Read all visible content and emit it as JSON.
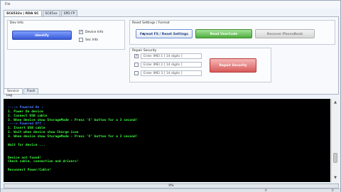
{
  "menu": {
    "file_label": "File"
  },
  "tabs": [
    {
      "label": "SC6532x | RDA SC",
      "active": true
    },
    {
      "label": "SC65xx",
      "active": false
    },
    {
      "label": "SPD FP",
      "active": false
    }
  ],
  "dev_info": {
    "title": "Dev Info",
    "identify_label": "Identify",
    "device_info_label": "Device Info",
    "device_info_checked": true,
    "sec_info_label": "Sec Info",
    "sec_info_checked": false
  },
  "reset": {
    "title": "Reset Settings / Format",
    "format_label": "Format FS / Reset Settings",
    "read_usercode_label": "Read UserCode",
    "recover_phonebook_label": "Recover PhoneBook"
  },
  "repair": {
    "title": "Repair Security",
    "imeis": [
      {
        "placeholder": "Enter IMEI 1 [ 14 digits ]",
        "checked": true
      },
      {
        "placeholder": "Enter IMEI 2 [ 14 digits ]",
        "checked": false
      },
      {
        "placeholder": "Enter IMEI 3 [ 14 digits ]",
        "checked": false
      }
    ],
    "repair_label": "Repair Security"
  },
  "subtabs": [
    {
      "label": "Service",
      "active": true
    },
    {
      "label": "Flash",
      "active": false
    }
  ],
  "log": {
    "label": "Log",
    "lines": [
      {
        "text": "",
        "color": "green"
      },
      {
        "text": "----> Powered On :",
        "color": "blue"
      },
      {
        "text": "1. Power On device",
        "color": "green"
      },
      {
        "text": "2. Connect USB cable",
        "color": "green"
      },
      {
        "text": "3. When device show StorageMode : Press 'X' button for a 3 second!",
        "color": "green"
      },
      {
        "text": "----> Powered Off :",
        "color": "blue"
      },
      {
        "text": "1. Insert USB cable",
        "color": "green"
      },
      {
        "text": "2. Wait when device show Charge icon",
        "color": "green"
      },
      {
        "text": "3. When device show StorageMode : Press 'X' button for a 3 second!",
        "color": "green"
      },
      {
        "text": "",
        "color": "green"
      },
      {
        "text": "Wait for device ...",
        "color": "green"
      },
      {
        "text": "",
        "color": "green"
      },
      {
        "text": "",
        "color": "green"
      },
      {
        "text": "Device not found!",
        "color": "green"
      },
      {
        "text": "Check cable, connection and drivers!",
        "color": "green"
      },
      {
        "text": "",
        "color": "green"
      },
      {
        "text": "Reconnect Power/Cable!",
        "color": "green"
      }
    ]
  },
  "progress": {
    "label": "0%",
    "value": 0
  },
  "status": {
    "left_value": "0",
    "right_value": "0"
  }
}
